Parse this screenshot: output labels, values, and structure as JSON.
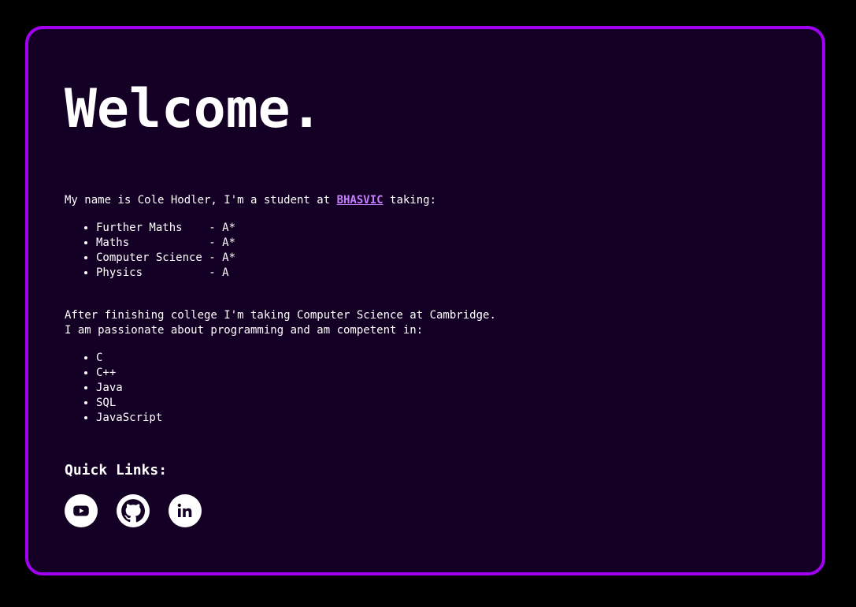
{
  "page": {
    "title": "Welcome."
  },
  "intro": {
    "before_link": "My name is Cole Hodler, I'm a student at ",
    "link_label": "BHASVIC",
    "after_link": " taking:"
  },
  "subjects": [
    {
      "label": "Further Maths    - A*"
    },
    {
      "label": "Maths            - A*"
    },
    {
      "label": "Computer Science - A*"
    },
    {
      "label": "Physics          - A"
    }
  ],
  "about": {
    "line1": "After finishing college I'm taking Computer Science at Cambridge.",
    "line2": "I am passionate about programming and am competent in:"
  },
  "languages": [
    {
      "label": "C"
    },
    {
      "label": "C++"
    },
    {
      "label": "Java"
    },
    {
      "label": "SQL"
    },
    {
      "label": "JavaScript"
    }
  ],
  "quick_links": {
    "heading": "Quick Links:",
    "icons": [
      "youtube-icon",
      "github-icon",
      "linkedin-icon"
    ]
  },
  "colors": {
    "background": "#000000",
    "card": "#130024",
    "border": "#a200f2",
    "link": "#c77dff",
    "text": "#ffffff"
  }
}
